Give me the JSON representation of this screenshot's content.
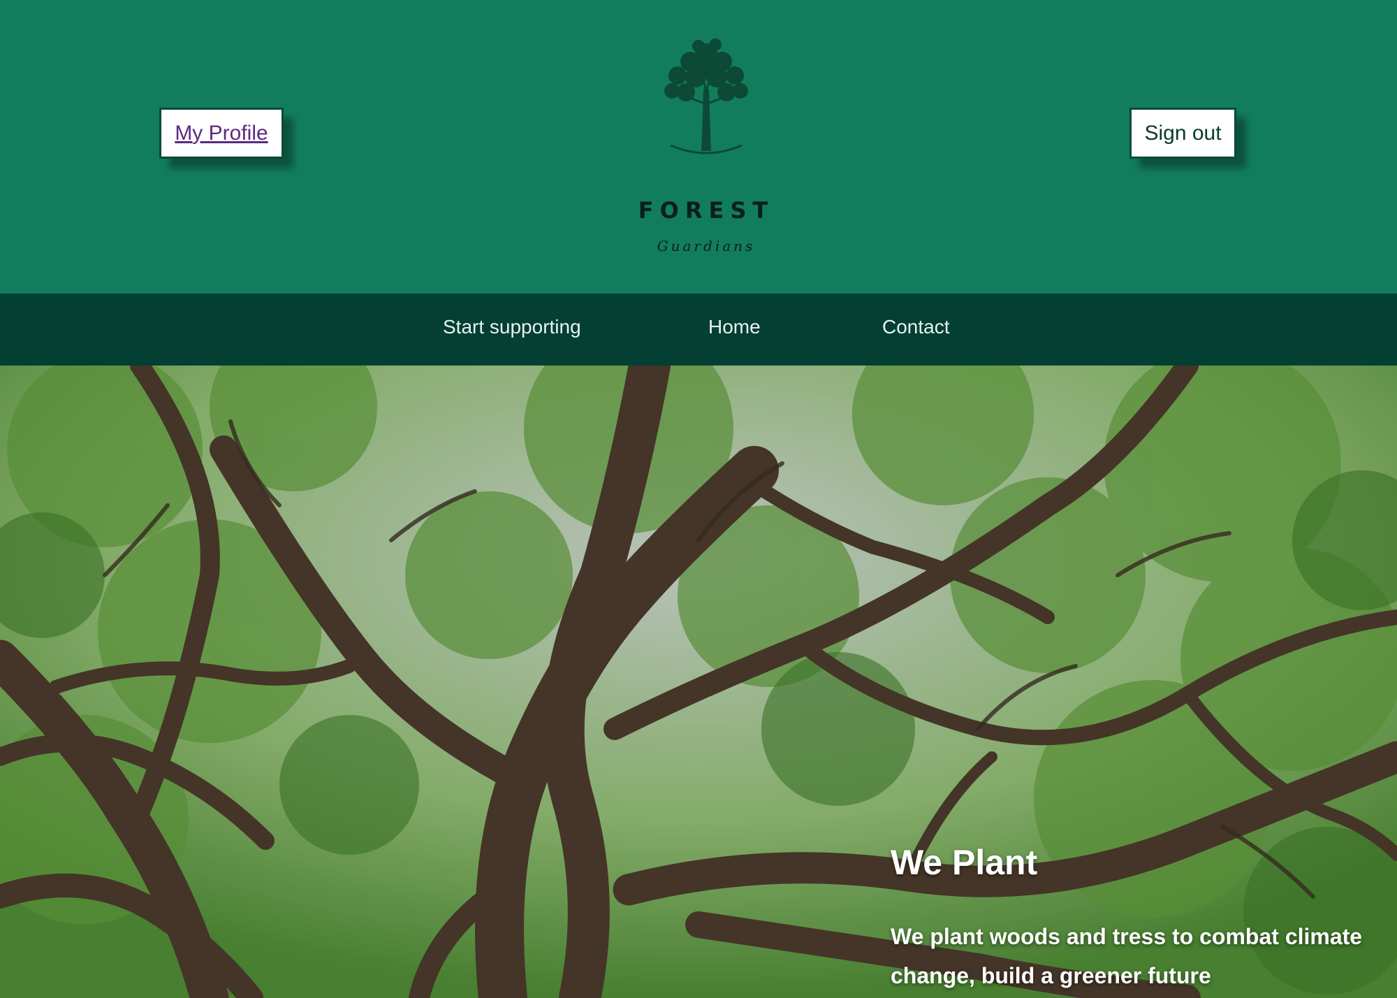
{
  "header": {
    "profile_label": "My Profile",
    "signout_label": "Sign out",
    "logo_title": "FOREST",
    "logo_subtitle": "Guardians"
  },
  "nav": {
    "items": [
      {
        "label": "Start supporting"
      },
      {
        "label": "Home"
      },
      {
        "label": "Contact"
      }
    ]
  },
  "hero": {
    "title": "We Plant",
    "text": "We plant woods and tress to combat climate change, build a greener future"
  },
  "colors": {
    "header_bg": "#127d5d",
    "nav_bg": "#033f33",
    "profile_link": "#5a2a82"
  }
}
